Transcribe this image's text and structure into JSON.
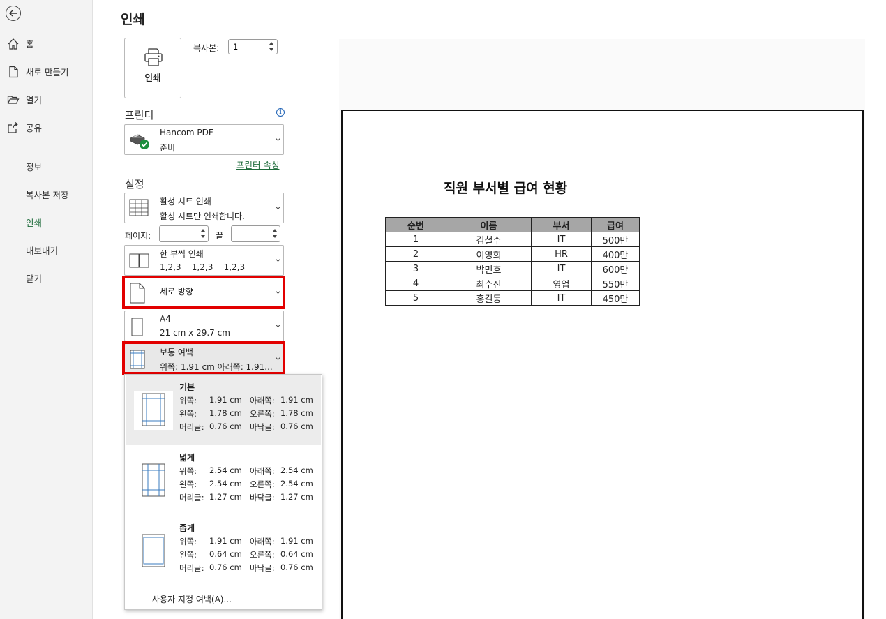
{
  "nav": {
    "items": [
      {
        "label": "홈"
      },
      {
        "label": "새로 만들기"
      },
      {
        "label": "열기"
      },
      {
        "label": "공유"
      },
      {
        "label": "정보"
      },
      {
        "label": "복사본 저장"
      },
      {
        "label": "인쇄",
        "active": true
      },
      {
        "label": "내보내기"
      },
      {
        "label": "닫기"
      }
    ]
  },
  "page_title": "인쇄",
  "print_button": {
    "label": "인쇄"
  },
  "copies": {
    "label": "복사본:",
    "value": "1"
  },
  "printer": {
    "section_label": "프린터",
    "name": "Hancom PDF",
    "status": "준비",
    "properties_link": "프린터 속성"
  },
  "settings": {
    "section_label": "설정",
    "scope": {
      "title": "활성 시트 인쇄",
      "subtitle": "활성 시트만 인쇄합니다."
    },
    "pages": {
      "label": "페이지:",
      "to_label": "끝",
      "from": "",
      "to": ""
    },
    "collate": {
      "title": "한 부씩 인쇄",
      "subtitle": "1,2,3    1,2,3    1,2,3"
    },
    "orientation": {
      "title": "세로 방향"
    },
    "paper": {
      "title": "A4",
      "subtitle": "21 cm x 29.7 cm"
    },
    "margins": {
      "title": "보통 여백",
      "subtitle": "위쪽: 1.91 cm 아래쪽: 1.91..."
    }
  },
  "margin_menu": {
    "options": [
      {
        "name": "기본",
        "rows": [
          {
            "k1": "위쪽:",
            "v1": "1.91 cm",
            "k2": "아래쪽:",
            "v2": "1.91 cm"
          },
          {
            "k1": "왼쪽:",
            "v1": "1.78 cm",
            "k2": "오른쪽:",
            "v2": "1.78 cm"
          },
          {
            "k1": "머리글:",
            "v1": "0.76 cm",
            "k2": "바닥글:",
            "v2": "0.76 cm"
          }
        ]
      },
      {
        "name": "넓게",
        "rows": [
          {
            "k1": "위쪽:",
            "v1": "2.54 cm",
            "k2": "아래쪽:",
            "v2": "2.54 cm"
          },
          {
            "k1": "왼쪽:",
            "v1": "2.54 cm",
            "k2": "오른쪽:",
            "v2": "2.54 cm"
          },
          {
            "k1": "머리글:",
            "v1": "1.27 cm",
            "k2": "바닥글:",
            "v2": "1.27 cm"
          }
        ]
      },
      {
        "name": "좁게",
        "rows": [
          {
            "k1": "위쪽:",
            "v1": "1.91 cm",
            "k2": "아래쪽:",
            "v2": "1.91 cm"
          },
          {
            "k1": "왼쪽:",
            "v1": "0.64 cm",
            "k2": "오른쪽:",
            "v2": "0.64 cm"
          },
          {
            "k1": "머리글:",
            "v1": "0.76 cm",
            "k2": "바닥글:",
            "v2": "0.76 cm"
          }
        ]
      }
    ],
    "custom_label": "사용자 지정 여백(A)..."
  },
  "preview": {
    "sheet_title": "직원 부서별 급여 현황",
    "table": {
      "headers": [
        "순번",
        "이름",
        "부서",
        "급여"
      ],
      "rows": [
        [
          "1",
          "김철수",
          "IT",
          "500만"
        ],
        [
          "2",
          "이영희",
          "HR",
          "400만"
        ],
        [
          "3",
          "박민호",
          "IT",
          "600만"
        ],
        [
          "4",
          "최수진",
          "영업",
          "550만"
        ],
        [
          "5",
          "홍길동",
          "IT",
          "450만"
        ]
      ]
    }
  },
  "colors": {
    "accent": "#1d6b3a",
    "highlight": "#e20000",
    "link": "#1a5fb4"
  }
}
